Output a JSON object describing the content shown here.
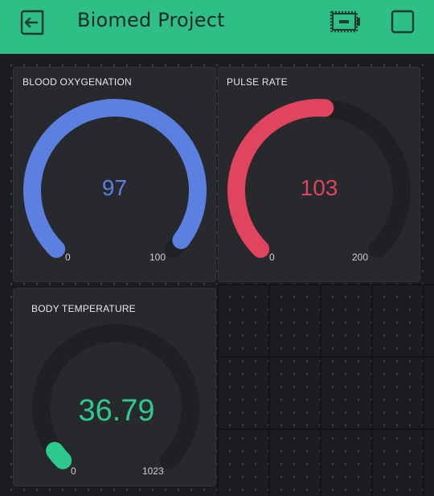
{
  "app": {
    "title": "Biomed Project",
    "header_color": "#2ebf86",
    "icons": {
      "exit": "exit-icon",
      "device": "device-status-icon",
      "menu": "square-icon"
    }
  },
  "widgets": [
    {
      "title": "BLOOD OXYGENATION",
      "value": "97",
      "min": "0",
      "max": "100",
      "level": 0.97,
      "color": "#5b80e0"
    },
    {
      "title": "PULSE RATE",
      "value": "103",
      "min": "0",
      "max": "200",
      "level": 0.515,
      "color": "#e0445f"
    },
    {
      "title": "BODY TEMPERATURE",
      "value": "36.79",
      "min": "0",
      "max": "1023",
      "level": 0.036,
      "color": "#2ec98e"
    }
  ]
}
